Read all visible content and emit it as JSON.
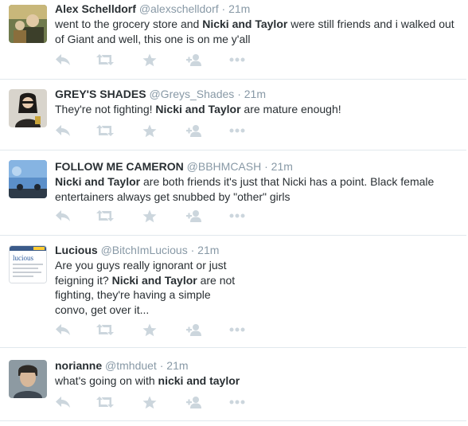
{
  "tweets": [
    {
      "fullname": "Alex Schelldorf",
      "username": "@alexschelldorf",
      "dot": "·",
      "time": "21m",
      "text_parts": [
        "went to the grocery store and ",
        "Nicki and Taylor",
        " were still friends and i walked out of Giant and well, this one is on me y'all"
      ]
    },
    {
      "fullname": "GREY'S SHADES",
      "username": "@Greys_Shades",
      "dot": "·",
      "time": "21m",
      "text_parts": [
        "They're not fighting! ",
        "Nicki and Taylor",
        " are mature enough!"
      ]
    },
    {
      "fullname": "FOLLOW ME CAMERON",
      "username": "@BBHMCASH",
      "dot": "·",
      "time": "21m",
      "text_parts": [
        "",
        "Nicki and Taylor",
        " are both friends it's just that Nicki has a point. Black female entertainers always get snubbed by \"other\" girls"
      ]
    },
    {
      "fullname": "Lucious",
      "username": "@BitchImLucious",
      "dot": "·",
      "time": "21m",
      "text_parts": [
        "Are you guys really ignorant or just feigning it? ",
        "Nicki and Taylor",
        " are not fighting, they're having a simple convo, get over it..."
      ],
      "avatar_text": "lucious"
    },
    {
      "fullname": "norianne",
      "username": "@tmhduet",
      "dot": "·",
      "time": "21m",
      "text_parts": [
        "what's going on with ",
        "nicki and taylor",
        ""
      ]
    }
  ],
  "actions": [
    "reply-icon",
    "retweet-icon",
    "favorite-icon",
    "follow-icon",
    "more-icon"
  ],
  "colors": {
    "name": "#292f33",
    "meta": "#8899a6",
    "icon": "#ccd6dd",
    "divider": "#e1e8ed"
  }
}
